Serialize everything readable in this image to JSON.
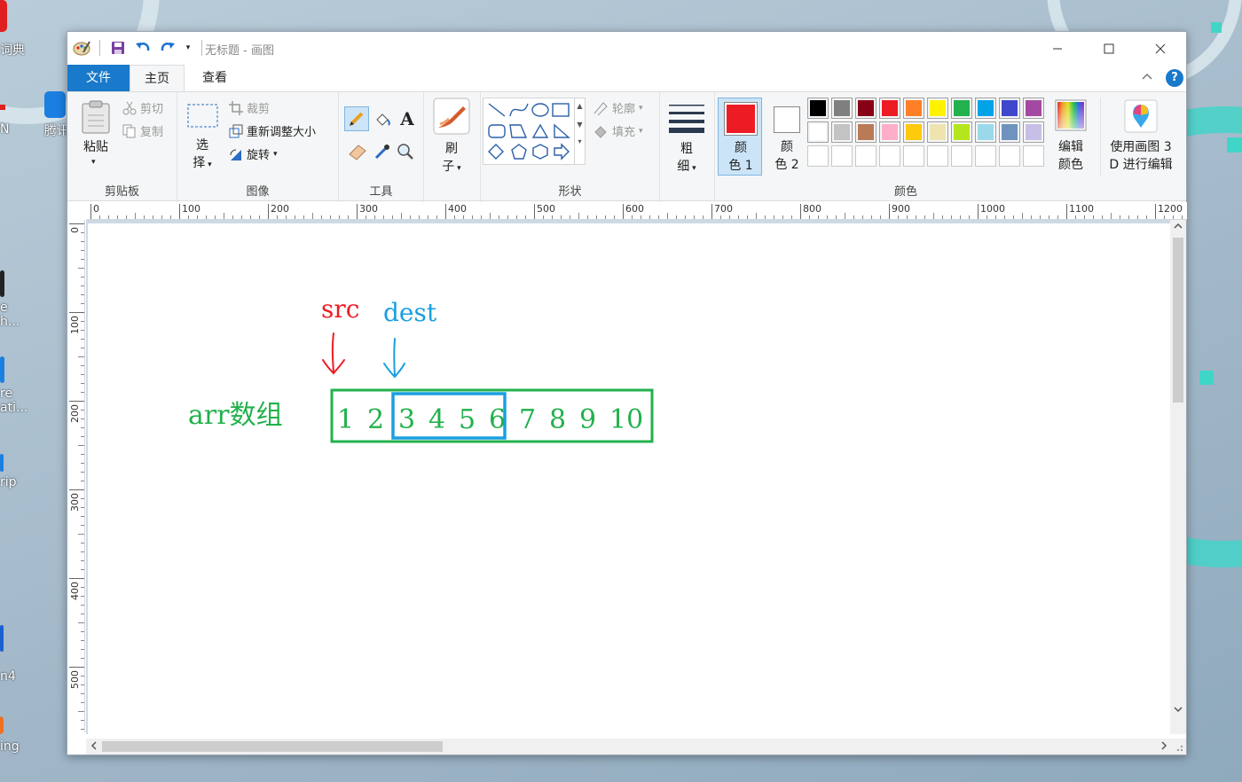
{
  "window": {
    "title": "无标题 - 画图"
  },
  "tabs": {
    "file": "文件",
    "home": "主页",
    "view": "查看"
  },
  "clipboard": {
    "paste": "粘贴",
    "cut": "剪切",
    "copy": "复制",
    "label": "剪贴板"
  },
  "image": {
    "select_1": "选",
    "select_2": "择",
    "crop": "裁剪",
    "resize": "重新调整大小",
    "rotate": "旋转",
    "label": "图像"
  },
  "tools": {
    "label": "工具"
  },
  "brushes": {
    "label_1": "刷",
    "label_2": "子"
  },
  "shapes": {
    "outline": "轮廓",
    "fill": "填充",
    "label": "形状"
  },
  "size": {
    "label_1": "粗",
    "label_2": "细"
  },
  "colors": {
    "color1_1": "颜",
    "color1_2": "色 1",
    "color2_1": "颜",
    "color2_2": "色 2",
    "edit_1": "编辑",
    "edit_2": "颜色",
    "paint3d_1": "使用画图 3",
    "paint3d_2": "D 进行编辑",
    "label": "颜色",
    "color1_value": "#ed1c24",
    "color2_value": "#ffffff",
    "palette_row1": [
      "#000000",
      "#7f7f7f",
      "#880015",
      "#ed1c24",
      "#ff7f27",
      "#fff200",
      "#22b14c",
      "#00a2e8",
      "#3f48cc",
      "#a349a4"
    ],
    "palette_row2": [
      "#ffffff",
      "#c3c3c3",
      "#b97a57",
      "#ffaec9",
      "#ffc90e",
      "#efe4b0",
      "#b5e61d",
      "#99d9ea",
      "#7092be",
      "#c8bfe7"
    ]
  },
  "ruler": {
    "h": [
      "0",
      "100",
      "200",
      "300",
      "400",
      "500",
      "600",
      "700",
      "800",
      "900",
      "1000",
      "1100",
      "1200"
    ],
    "v": [
      "0",
      "100",
      "200",
      "300",
      "400",
      "500"
    ]
  },
  "drawing": {
    "src": "src",
    "dest": "dest",
    "arr_label": "arr数组",
    "numbers": [
      "1",
      "2",
      "3",
      "4",
      "5",
      "6",
      "7",
      "8",
      "9",
      "10"
    ],
    "red": "#ed1c24",
    "blue": "#1a9fe0",
    "green": "#22b14c"
  },
  "desktop": {
    "icons": [
      "词典",
      "N",
      "腾讯",
      "e",
      "h...",
      "re",
      "ati...",
      "rip",
      "n4",
      "ing"
    ]
  }
}
